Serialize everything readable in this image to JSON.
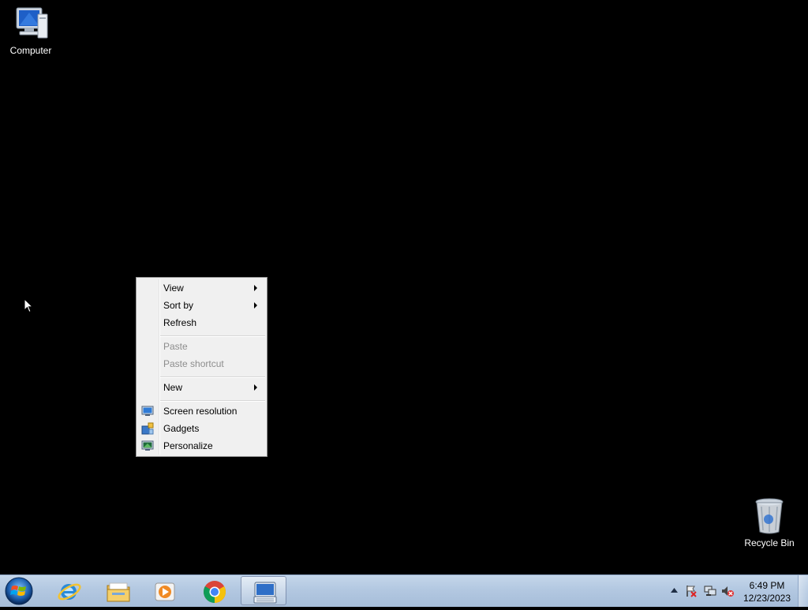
{
  "desktop": {
    "icons": [
      {
        "label": "Computer"
      },
      {
        "label": "Recycle Bin"
      }
    ]
  },
  "context_menu": {
    "items": [
      {
        "label": "View",
        "submenu": true,
        "enabled": true
      },
      {
        "label": "Sort by",
        "submenu": true,
        "enabled": true
      },
      {
        "label": "Refresh",
        "enabled": true
      },
      {
        "label": "Paste",
        "enabled": false
      },
      {
        "label": "Paste shortcut",
        "enabled": false
      },
      {
        "label": "New",
        "submenu": true,
        "enabled": true
      },
      {
        "label": "Screen resolution",
        "icon": "monitor-icon",
        "enabled": true
      },
      {
        "label": "Gadgets",
        "icon": "gadgets-icon",
        "enabled": true
      },
      {
        "label": "Personalize",
        "icon": "personalize-icon",
        "enabled": true
      }
    ]
  },
  "taskbar": {
    "pinned": [
      {
        "icon": "internet-explorer-icon"
      },
      {
        "icon": "file-explorer-icon"
      },
      {
        "icon": "media-player-icon"
      },
      {
        "icon": "chrome-icon"
      },
      {
        "icon": "keyboard-app-icon",
        "active": true
      }
    ],
    "tray": {
      "icons": [
        "show-hidden-icons-arrow",
        "action-center-flag-icon",
        "network-icon",
        "volume-muted-icon"
      ],
      "time": "6:49 PM",
      "date": "12/23/2023"
    }
  }
}
